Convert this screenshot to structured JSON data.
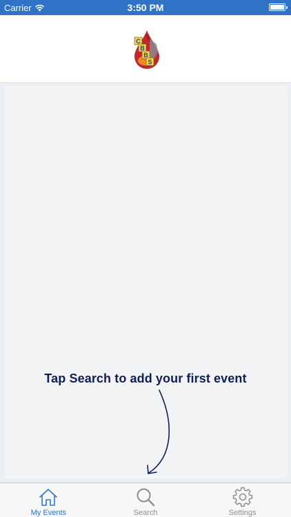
{
  "status_bar": {
    "carrier": "Carrier",
    "time": "3:50 PM",
    "bar_color": "#2f73c7"
  },
  "header": {
    "logo_icon": "cbbs-blood-drop-logo",
    "logo_letters": [
      "C",
      "B",
      "B",
      "S"
    ]
  },
  "main": {
    "hint": "Tap Search to add your first event",
    "hint_color": "#111e54"
  },
  "tab_bar": {
    "active_color": "#2f73c7",
    "tabs": [
      {
        "label": "My Events",
        "icon": "home-icon",
        "active": true
      },
      {
        "label": "Search",
        "icon": "search-icon",
        "active": false
      },
      {
        "label": "Settings",
        "icon": "gear-icon",
        "active": false
      }
    ]
  }
}
